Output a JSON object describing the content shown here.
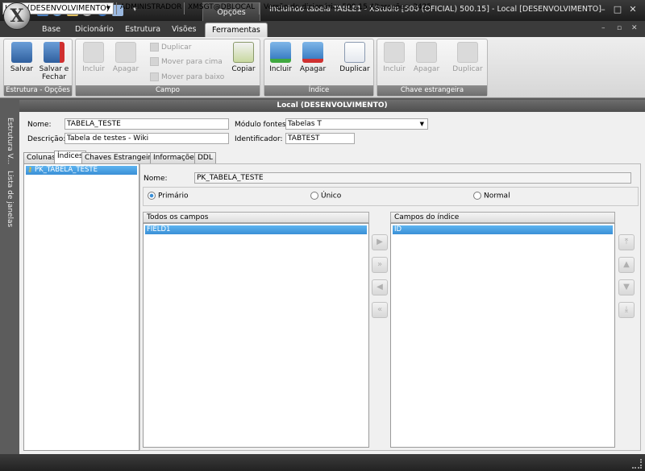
{
  "window": {
    "title": "Incluindo tabela TABLE1 - XStudio [500 (OFICIAL) 500.15] - Local [DESENVOLVIMENTO]",
    "context_tab_header": "Opções",
    "controls": {
      "minimize": "–",
      "maximize": "□",
      "close": "✕"
    },
    "mdi_controls": {
      "minimize": "–",
      "restore": "▫",
      "close": "✕"
    }
  },
  "ribbon": {
    "tabs": [
      {
        "label": "Base"
      },
      {
        "label": "Dicionário"
      },
      {
        "label": "Estrutura"
      },
      {
        "label": "Visões"
      },
      {
        "label": "Ferramentas",
        "active": true
      }
    ],
    "groups": {
      "estrutura": {
        "label": "Estrutura - Opções",
        "buttons": {
          "salvar": "Salvar",
          "salvar_fechar_1": "Salvar e",
          "salvar_fechar_2": "Fechar"
        }
      },
      "campo": {
        "label": "Campo",
        "buttons": {
          "incluir": "Incluir",
          "apagar": "Apagar",
          "duplicar": "Duplicar",
          "mover_cima": "Mover para cima",
          "mover_baixo": "Mover para baixo",
          "copiar": "Copiar"
        }
      },
      "indice": {
        "label": "Índice",
        "buttons": {
          "incluir": "Incluir",
          "apagar": "Apagar",
          "duplicar": "Duplicar"
        }
      },
      "chave": {
        "label": "Chave estrangeira",
        "buttons": {
          "incluir": "Incluir",
          "apagar": "Apagar",
          "duplicar": "Duplicar"
        }
      }
    }
  },
  "document": {
    "header": "Local (DESENVOLVIMENTO)",
    "side_panels": {
      "estrutura": "Estrutura V...",
      "janelas": "Lista de janelas"
    },
    "form": {
      "nome_label": "Nome:",
      "nome_value": "TABELA_TESTE",
      "descricao_label": "Descrição:",
      "descricao_value": "Tabela de testes - Wiki",
      "modulo_label": "Módulo fontes:",
      "modulo_value": "Tabelas T",
      "identificador_label": "Identificador:",
      "identificador_value": "TABTEST"
    },
    "tabs": [
      {
        "label": "Colunas"
      },
      {
        "label": "Índices",
        "active": true
      },
      {
        "label": "Chaves Estrangeiras"
      },
      {
        "label": "Informações"
      },
      {
        "label": "DDL"
      }
    ],
    "index_list": [
      "PK_TABELA_TESTE"
    ],
    "index_detail": {
      "nome_label": "Nome:",
      "nome_value": "PK_TABELA_TESTE",
      "types": [
        {
          "label": "Primário",
          "selected": true
        },
        {
          "label": "Único",
          "selected": false
        },
        {
          "label": "Normal",
          "selected": false
        }
      ],
      "all_fields_header": "Todos os campos",
      "all_fields": [
        "FIELD1"
      ],
      "index_fields_header": "Campos do índice",
      "index_fields": [
        "ID"
      ]
    }
  },
  "statusbar": {
    "connection": "Local (DESENVOLVIMENTO)",
    "user": "ADMINISTRADOR",
    "database": "XMSGT@DBLOCAL",
    "version": "Versão do dicionário: 500.15 Alterações: 2425"
  },
  "colors": {
    "accent": "#3a8fd6",
    "ribbon_label_bg": "#7a7a7a",
    "titlebar": "#2a2a2a"
  }
}
